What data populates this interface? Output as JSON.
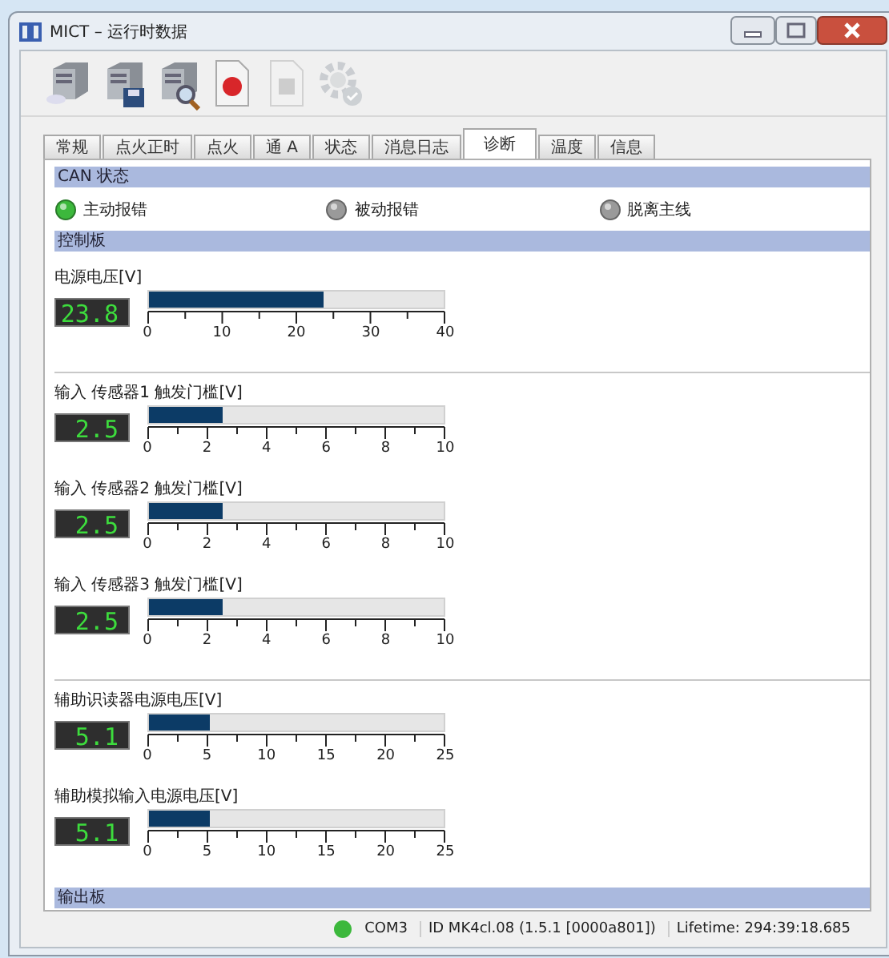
{
  "window": {
    "title": "MICT – 运行时数据"
  },
  "toolbar": [
    {
      "kind": "server",
      "disabled": false
    },
    {
      "kind": "server-save",
      "disabled": false
    },
    {
      "kind": "server-search",
      "disabled": false
    },
    {
      "kind": "record",
      "disabled": false
    },
    {
      "kind": "stop",
      "disabled": true
    },
    {
      "kind": "gear",
      "disabled": true
    }
  ],
  "tabs": [
    {
      "label": "常规",
      "selected": false
    },
    {
      "label": "点火正时",
      "selected": false
    },
    {
      "label": "点火",
      "selected": false
    },
    {
      "label": "通 A",
      "selected": false
    },
    {
      "label": "状态",
      "selected": false
    },
    {
      "label": "消息日志",
      "selected": false
    },
    {
      "label": "诊断",
      "selected": true
    },
    {
      "label": "温度",
      "selected": false
    },
    {
      "label": "信息",
      "selected": false
    }
  ],
  "can_status": {
    "title": "CAN 状态",
    "indicators": [
      {
        "label": "主动报错",
        "on": true
      },
      {
        "label": "被动报错",
        "on": false
      },
      {
        "label": "脱离主线",
        "on": false
      }
    ]
  },
  "control_board": {
    "title": "控制板",
    "groups": [
      {
        "gauges": [
          {
            "label": "电源电压[V]",
            "reading": "23.8",
            "level": 0.595,
            "ticks": [
              "0",
              "10",
              "20",
              "30",
              "40"
            ]
          }
        ]
      },
      {
        "gauges": [
          {
            "label": "输入 传感器1 触发门槛[V]",
            "reading": "2.5",
            "level": 0.25,
            "ticks": [
              "0",
              "2",
              "4",
              "6",
              "8",
              "10"
            ]
          },
          {
            "label": "输入 传感器2 触发门槛[V]",
            "reading": "2.5",
            "level": 0.25,
            "ticks": [
              "0",
              "2",
              "4",
              "6",
              "8",
              "10"
            ]
          },
          {
            "label": "输入 传感器3 触发门槛[V]",
            "reading": "2.5",
            "level": 0.25,
            "ticks": [
              "0",
              "2",
              "4",
              "6",
              "8",
              "10"
            ]
          }
        ]
      },
      {
        "gauges": [
          {
            "label": "辅助识读器电源电压[V]",
            "reading": "5.1",
            "level": 0.204,
            "ticks": [
              "0",
              "5",
              "10",
              "15",
              "20",
              "25"
            ]
          },
          {
            "label": "辅助模拟输入电源电压[V]",
            "reading": "5.1",
            "level": 0.204,
            "ticks": [
              "0",
              "5",
              "10",
              "15",
              "20",
              "25"
            ]
          }
        ]
      }
    ]
  },
  "output_board": {
    "title": "输出板"
  },
  "status_bar": {
    "connected": true,
    "port": "COM3",
    "device": "ID MK4cl.08 (1.5.1 [0000a801])",
    "lifetime": "Lifetime: 294:39:18.685"
  }
}
